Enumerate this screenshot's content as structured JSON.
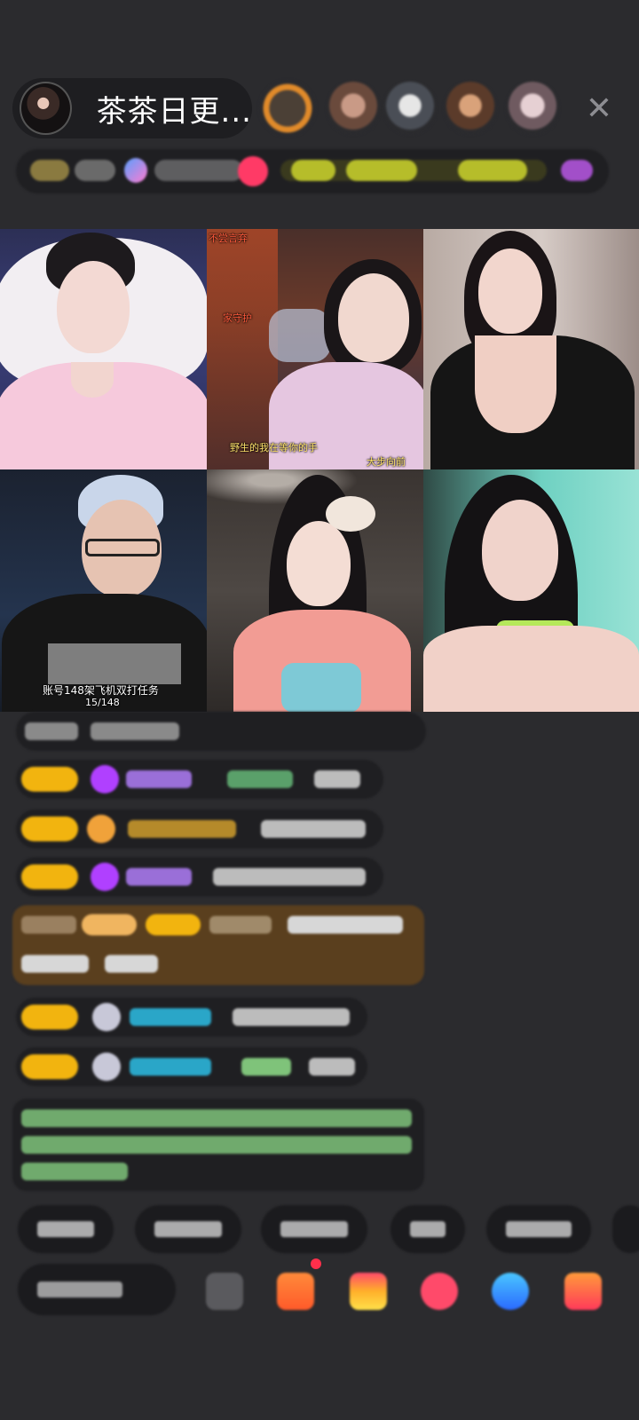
{
  "header": {
    "host_name": "茶茶日更...",
    "viewer_avatars": [
      "viewer-1",
      "viewer-2",
      "viewer-3",
      "viewer-4",
      "viewer-5"
    ],
    "close_icon": "close-icon"
  },
  "video_grid": {
    "tiles": [
      {
        "id": "tile-1",
        "captions": []
      },
      {
        "id": "tile-2",
        "captions": [
          "不尝言弃",
          "家守护",
          "野生的我在等你的手",
          "大步向前"
        ]
      },
      {
        "id": "tile-3",
        "captions": []
      },
      {
        "id": "tile-4",
        "captions": [
          "账号148架飞机双打任务",
          "15/148"
        ]
      },
      {
        "id": "tile-5",
        "captions": []
      },
      {
        "id": "tile-6",
        "captions": []
      }
    ]
  },
  "colors": {
    "background": "#2b2b2e",
    "panel": "#1f1f22",
    "badge_gold": "#f2b40f",
    "highlight_brown": "#5a3f1e",
    "gem_purple": "#b040ff",
    "username_teal": "#2aa6c8",
    "message_green": "#7fc37a"
  },
  "bottom_bar": {
    "icons": [
      "grid-icon",
      "gift-box-icon",
      "rainbow-icon",
      "red-heart-icon",
      "blue-chat-icon",
      "red-gift-icon"
    ]
  }
}
